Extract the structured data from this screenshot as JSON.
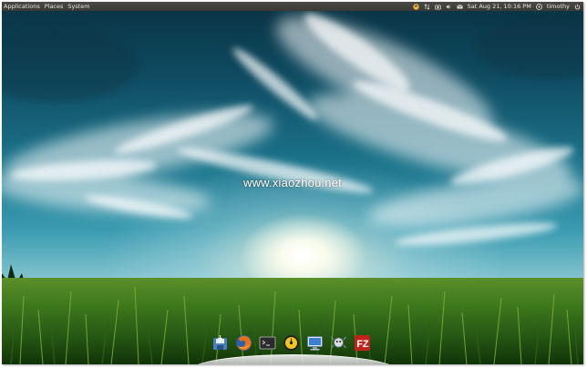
{
  "top_panel": {
    "menu": [
      "Applications",
      "Places",
      "System"
    ],
    "datetime": "Sat Aug 21, 10:16 PM",
    "user": "timothy",
    "tray_icons": [
      "update-icon",
      "network-icon",
      "camera-icon",
      "volume-icon",
      "mail-icon"
    ]
  },
  "desktop": {
    "watermark": "www.xiaozhou.net"
  },
  "dock": {
    "items": [
      "save-icon",
      "firefox-icon",
      "terminal-icon",
      "monitor-icon",
      "network-preferences-icon",
      "sound-settings-icon",
      "filezilla-icon"
    ]
  },
  "colors": {
    "panel": "#3f3e3a",
    "panel_text": "#e8e6e0",
    "sky_top": "#0a3546",
    "grass": "#3f7a1d",
    "filezilla": "#c0221c"
  }
}
